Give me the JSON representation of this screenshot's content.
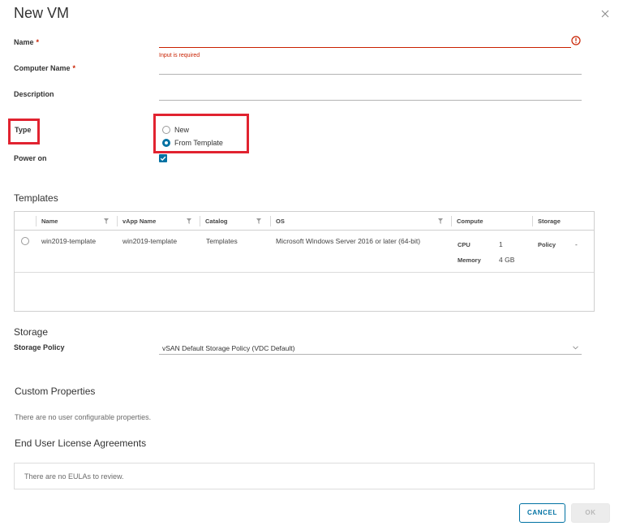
{
  "dialog": {
    "title": "New VM",
    "close_icon": "close-icon"
  },
  "form": {
    "name": {
      "label": "Name",
      "required_mark": "*",
      "value": "",
      "error": "Input is required"
    },
    "computer_name": {
      "label": "Computer Name",
      "required_mark": "*",
      "value": ""
    },
    "description": {
      "label": "Description",
      "value": ""
    },
    "type": {
      "label": "Type",
      "options": [
        {
          "label": "New",
          "checked": false
        },
        {
          "label": "From Template",
          "checked": true
        }
      ]
    },
    "power_on": {
      "label": "Power on",
      "checked": true
    }
  },
  "templates": {
    "title": "Templates",
    "columns": [
      "Name",
      "vApp Name",
      "Catalog",
      "OS",
      "Compute",
      "Storage"
    ],
    "rows": [
      {
        "name": "win2019-template",
        "vapp_name": "win2019-template",
        "catalog": "Templates",
        "os": "Microsoft Windows Server 2016 or later (64-bit)",
        "cpu_label": "CPU",
        "cpu_value": "1",
        "memory_label": "Memory",
        "memory_value": "4 GB",
        "storage_label": "Policy",
        "storage_value": "-"
      }
    ]
  },
  "storage": {
    "title": "Storage",
    "policy_label": "Storage Policy",
    "policy_value": "vSAN Default Storage Policy (VDC Default)"
  },
  "custom_properties": {
    "title": "Custom Properties",
    "empty_text": "There are no user configurable properties."
  },
  "eula": {
    "title": "End User License Agreements",
    "empty_text": "There are no EULAs to review."
  },
  "buttons": {
    "cancel": "CANCEL",
    "ok": "OK"
  },
  "colors": {
    "primary": "#0072a3",
    "error": "#c92100",
    "highlight": "#e12330"
  }
}
